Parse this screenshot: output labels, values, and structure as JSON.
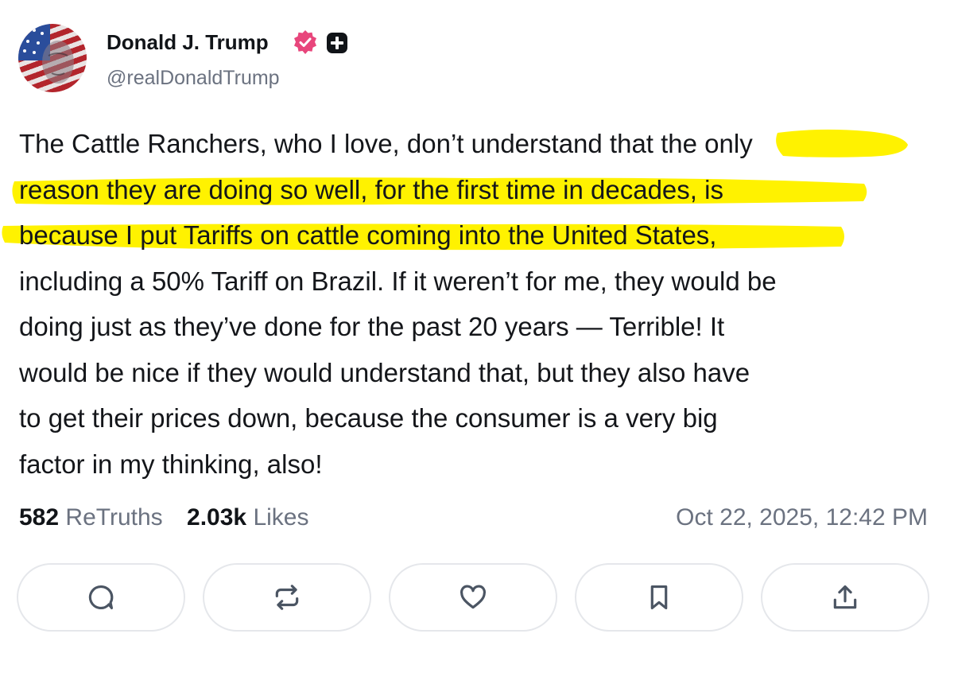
{
  "author": {
    "display_name": "Donald J. Trump",
    "handle": "@realDonaldTrump",
    "verified_icon": "verified-badge-icon",
    "plus_icon": "plus-badge-icon",
    "avatar_icon": "flag-portrait-avatar"
  },
  "post": {
    "lines": [
      "The Cattle Ranchers, who I love, don’t understand that the only",
      "reason they are doing so well, for the first time in decades, is",
      "because I put Tariffs on cattle coming into the United States,",
      "including a 50% Tariff on Brazil. If it weren’t for me, they would be",
      "doing just as they’ve done for the past 20 years — Terrible! It",
      "would be nice if they would understand that, but they also have",
      "to get their prices down, because the consumer is a very big",
      "factor in my thinking, also!"
    ],
    "highlight_color": "#fff200"
  },
  "stats": {
    "retruths_count": "582",
    "retruths_label": "ReTruths",
    "likes_count": "2.03k",
    "likes_label": "Likes",
    "timestamp": "Oct 22, 2025, 12:42 PM"
  },
  "actions": [
    {
      "name": "reply",
      "icon": "comment-icon"
    },
    {
      "name": "retruth",
      "icon": "repost-icon"
    },
    {
      "name": "like",
      "icon": "heart-icon"
    },
    {
      "name": "bookmark",
      "icon": "bookmark-icon"
    },
    {
      "name": "share",
      "icon": "share-icon"
    }
  ],
  "colors": {
    "verified_pink": "#e8467c",
    "muted_text": "#6b7280",
    "border": "#e5e7eb"
  }
}
